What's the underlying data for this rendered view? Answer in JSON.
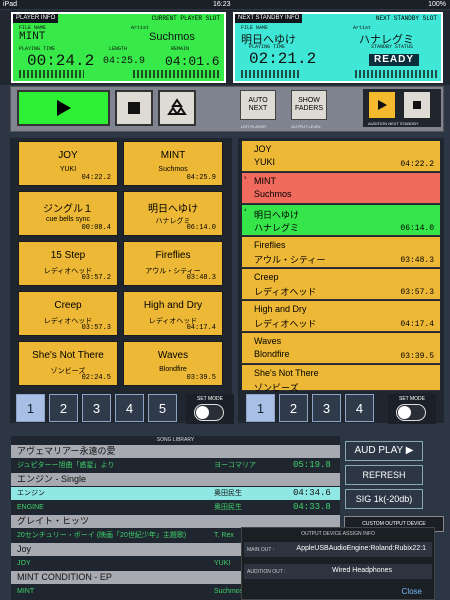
{
  "statusbar": {
    "device": "iPad",
    "time": "16:23",
    "battery": "100%"
  },
  "current_slot": {
    "tag": "PLAYER INFO",
    "title": "CURRENT PLAYER SLOT",
    "file_label": "FILE NAME",
    "file": "MINT",
    "artist_label": "Artist",
    "artist": "Suchmos",
    "playing_label": "PLAYING TIME",
    "playing": "00:24.2",
    "length_label": "LENGTH",
    "length": "04:25.9",
    "remain_label": "REMAIN",
    "remain": "04:01.6"
  },
  "next_slot": {
    "tag": "NEXT STANDBY INFO",
    "title": "NEXT STANDBY SLOT",
    "file_label": "FILE NAME",
    "file": "明日へゆけ",
    "artist_label": "Artist",
    "artist": "ハナレグミ",
    "playing_label": "PLAYING TIME",
    "playing": "02:21.2",
    "status_label": "STANDBY STATUS",
    "status": "READY"
  },
  "controls": {
    "auto_next": "AUTO NEXT",
    "list_player": "LIST PLAYER",
    "show_faders": "SHOW FADERS",
    "output_level": "OUTPUT LEVEL",
    "audition": "AUDITION NEXT STANDBY"
  },
  "tiles": [
    {
      "title": "JOY",
      "artist": "YUKI",
      "dur": "04:22.2"
    },
    {
      "title": "MINT",
      "artist": "Suchmos",
      "dur": "04:25.9"
    },
    {
      "title": "ジングル１",
      "artist": "cue bells sync",
      "dur": "00:08.4"
    },
    {
      "title": "明日へゆけ",
      "artist": "ハナレグミ",
      "dur": "06:14.0"
    },
    {
      "title": "15 Step",
      "artist": "レディオヘッド",
      "dur": "03:57.2"
    },
    {
      "title": "Fireflies",
      "artist": "アウル・シティー",
      "dur": "03:48.3"
    },
    {
      "title": "Creep",
      "artist": "レディオヘッド",
      "dur": "03:57.3"
    },
    {
      "title": "High and Dry",
      "artist": "レディオヘッド",
      "dur": "04:17.4"
    },
    {
      "title": "She's Not There",
      "artist": "ゾンビーズ",
      "dur": "02:24.5"
    },
    {
      "title": "Waves",
      "artist": "Blondfire",
      "dur": "03:39.5"
    }
  ],
  "list_items": [
    {
      "title": "JOY",
      "artist": "YUKI",
      "dur": "04:22.2",
      "num": ""
    },
    {
      "title": "MINT",
      "artist": "Suchmos",
      "dur": "",
      "num": "3"
    },
    {
      "title": "明日へゆけ",
      "artist": "ハナレグミ",
      "dur": "06:14.0",
      "num": "4"
    },
    {
      "title": "Fireflies",
      "artist": "アウル・シティー",
      "dur": "03:48.3",
      "num": ""
    },
    {
      "title": "Creep",
      "artist": "レディオヘッド",
      "dur": "03:57.3",
      "num": ""
    },
    {
      "title": "High and Dry",
      "artist": "レディオヘッド",
      "dur": "04:17.4",
      "num": ""
    },
    {
      "title": "Waves",
      "artist": "Blondfire",
      "dur": "03:39.5",
      "num": ""
    },
    {
      "title": "She's Not There",
      "artist": "ゾンビーズ",
      "dur": "",
      "num": ""
    }
  ],
  "left_pages": [
    "1",
    "2",
    "3",
    "4",
    "5"
  ],
  "right_pages": [
    "1",
    "2",
    "3",
    "4"
  ],
  "set_mode": "SET MODE",
  "library": {
    "header": "SONG LIBRARY",
    "rows": [
      {
        "kind": "group",
        "text": "アヴェマリアー永遠の愛",
        "c2": "",
        "c3": ""
      },
      {
        "kind": "song",
        "text": "ジュピターー旭曲「惑星」より",
        "c2": "ヨーコマリア",
        "c3": "05:19.8"
      },
      {
        "kind": "group",
        "text": "エンジン - Single",
        "c2": "",
        "c3": ""
      },
      {
        "kind": "sel",
        "text": "エンジン",
        "c2": "奥田民生",
        "c3": "04:34.6"
      },
      {
        "kind": "song",
        "text": "ENGINE",
        "c2": "奥田民生",
        "c3": "04:33.8"
      },
      {
        "kind": "group",
        "text": "グレイト・ヒッツ",
        "c2": "",
        "c3": ""
      },
      {
        "kind": "song",
        "text": "20センチュリー・ボーイ (映画「20世紀少年」主題歌)",
        "c2": "T. Rex",
        "c3": ""
      },
      {
        "kind": "group",
        "text": "Joy",
        "c2": "",
        "c3": ""
      },
      {
        "kind": "song",
        "text": "JOY",
        "c2": "YUKI",
        "c3": ""
      },
      {
        "kind": "group",
        "text": "MINT CONDITION - EP",
        "c2": "",
        "c3": ""
      },
      {
        "kind": "song",
        "text": "MINT",
        "c2": "Suchmos",
        "c3": ""
      }
    ]
  },
  "right_buttons": {
    "aud_play": "AUD PLAY ▶",
    "refresh": "REFRESH",
    "sig": "SIG 1k(-20db)",
    "custom": "CUSTOM OUTPUT DEVICE"
  },
  "overlay": {
    "header": "OUTPUT DEVICE ASSIGN INFO",
    "main_label": "MAIN OUT :",
    "main_value": "AppleUSBAudioEngine:Roland:Rubix22:1",
    "aud_label": "AUDITION OUT :",
    "aud_value": "Wired Headphones",
    "close": "Close"
  },
  "colors": {
    "current_green": "#37ea4a",
    "next_cyan": "#3fe7d6",
    "tile_yellow": "#edb835",
    "playing_red": "#f06a5e",
    "standby_green": "#35e54a"
  }
}
